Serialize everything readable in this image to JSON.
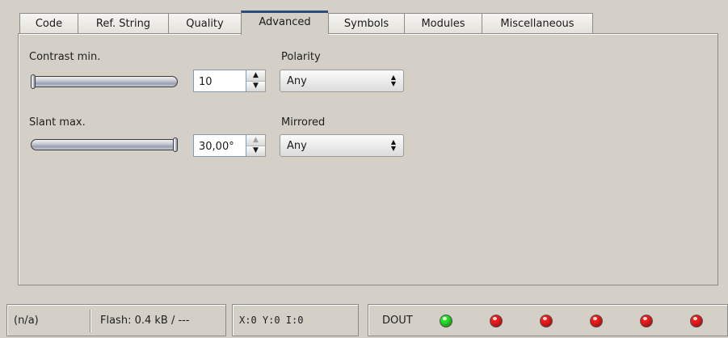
{
  "tabs": [
    {
      "label": "Code"
    },
    {
      "label": "Ref. String"
    },
    {
      "label": "Quality"
    },
    {
      "label": "Advanced",
      "active": true
    },
    {
      "label": "Symbols"
    },
    {
      "label": "Modules"
    },
    {
      "label": "Miscellaneous"
    }
  ],
  "advanced": {
    "contrast_min": {
      "label": "Contrast min.",
      "value": "10",
      "slider_fraction": 0.0
    },
    "slant_max": {
      "label": "Slant max.",
      "value": "30,00°",
      "slider_fraction": 1.0
    },
    "polarity": {
      "label": "Polarity",
      "value": "Any"
    },
    "mirrored": {
      "label": "Mirrored",
      "value": "Any"
    }
  },
  "status": {
    "state": "(n/a)",
    "flash": "Flash:  0.4 kB / ---",
    "position": "X:0 Y:0 I:0",
    "dout_label": "DOUT",
    "leds": [
      {
        "state": "on",
        "color": "#22cc22"
      },
      {
        "state": "off",
        "color": "#e01818"
      },
      {
        "state": "off",
        "color": "#e01818"
      },
      {
        "state": "off",
        "color": "#e01818"
      },
      {
        "state": "off",
        "color": "#e01818"
      },
      {
        "state": "off",
        "color": "#e01818"
      }
    ]
  },
  "colors": {
    "background": "#d4d0c8",
    "active_tab_accent": "#2b4d7e",
    "led_green": "#22cc22",
    "led_red": "#e01818"
  }
}
